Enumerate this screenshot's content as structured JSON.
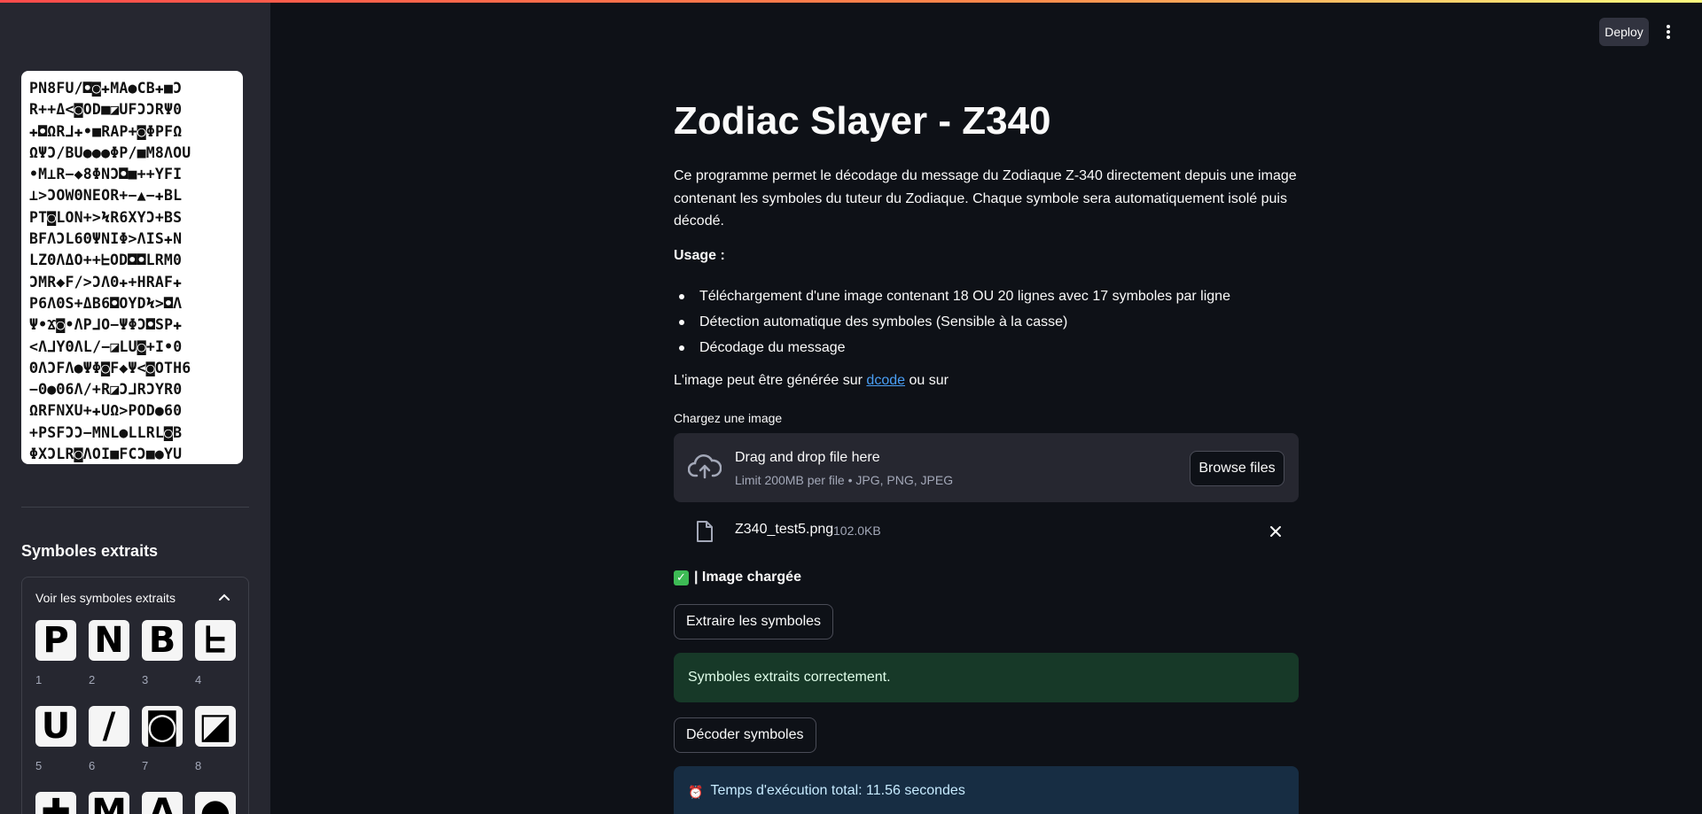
{
  "sidebar": {
    "cipher_lines": [
      "PN8FU/◘◙✚MA●CB✚■Ͻ",
      "R++Δ<◙OD■◪UFϽϽRΨ0",
      "✚◘ΩRᒧ✚•■RAP+◙ΦPFΩ",
      "ΩΨϽ/BU●●●ΦP/■M8ΛOU",
      "•M⊥R−◆8ΦNϽ◘■++YFI",
      "⊥>ϽOWΘNEOR+−▲−✚BL",
      "PT◙LON+>ϞR6XYϽ+BS",
      "BFΛϽL6ΘΨNIΦ>ΛIS✚N",
      "LZΘΛΔO++ᖶOD◘◘LRM0",
      "ϽMR◆F/>ϽΛΘ✚+HRAF✚",
      "P6ΛΘS+ΔB6◘OYDϞ>◘Λ",
      "Ψ•Ϫ◙•ΛPᒧO−ΨΦϽ◘SP✚",
      "<ΛᒧYΘΛL/−◪LU◙+I•0",
      "ΘΛϽFΛ●ΨΦ◙F◆Ψ<◙OTH6",
      "−Θ●Θ6Λ/+R◪ϽᒧRϽYR0",
      "ΩRFNXU+✚UΩ>POD●60",
      "+PSFϽϽ−MNL●LLRL◙B",
      "ΦXϽLR◙ΛOI■FCϽ■●YU"
    ],
    "section_title": "Symboles extraits",
    "expander_label": "Voir les symboles extraits",
    "symbols": [
      {
        "glyph": "P",
        "caption": "1"
      },
      {
        "glyph": "N",
        "caption": "2"
      },
      {
        "glyph": "B",
        "caption": "3"
      },
      {
        "glyph": "ᖶ",
        "caption": "4"
      },
      {
        "glyph": "U",
        "caption": "5"
      },
      {
        "glyph": "/",
        "caption": "6"
      },
      {
        "glyph": "◙",
        "caption": "7"
      },
      {
        "glyph": "◪",
        "caption": "8"
      },
      {
        "glyph": "✚",
        "caption": ""
      },
      {
        "glyph": "M",
        "caption": ""
      },
      {
        "glyph": "A",
        "caption": ""
      },
      {
        "glyph": "●",
        "caption": ""
      }
    ]
  },
  "header": {
    "deploy_label": "Deploy",
    "menu_icon": "vertical-ellipsis-icon"
  },
  "main": {
    "title": "Zodiac Slayer - Z340",
    "description": "Ce programme permet le décodage du message du Zodiaque Z-340 directement depuis une image contenant les symboles du tuteur du Zodiaque. Chaque symbole sera automatiquement isolé puis décodé.",
    "usage_label": "Usage :",
    "usage_items": [
      "Téléchargement d'une image contenant 18 OU 20 lignes avec 17 symboles par ligne",
      "Détection automatique des symboles (Sensible à la casse)",
      "Décodage du message"
    ],
    "gen_prefix": "L'image peut être générée sur ",
    "gen_link": "dcode",
    "gen_suffix": " ou sur",
    "uploader": {
      "label": "Chargez une image",
      "drop_title": "Drag and drop file here",
      "limit": "Limit 200MB per file • JPG, PNG, JPEG",
      "browse_label": "Browse files"
    },
    "file": {
      "name": "Z340_test5.png",
      "size": "102.0KB"
    },
    "loaded_text": "| Image chargée",
    "extract_button": "Extraire les symboles",
    "success_message": "Symboles extraits correctement.",
    "decode_button": "Décoder symboles",
    "info_message": "Temps d'exécution total: 11.56 secondes"
  },
  "colors": {
    "background": "#0e1117",
    "sidebar": "#262730",
    "link": "#4a9ff5",
    "success_bg": "#173928",
    "info_bg": "#172d43"
  }
}
